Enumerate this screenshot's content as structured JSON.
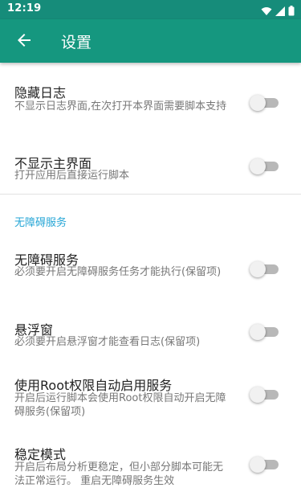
{
  "status_bar": {
    "time": "12:19",
    "icons": [
      "wifi-icon",
      "signal-icon",
      "battery-icon"
    ]
  },
  "app_bar": {
    "title": "设置",
    "back_icon": "arrow-back-icon",
    "color": "#15977f"
  },
  "settings": [
    {
      "title": "隐藏日志",
      "summary": "不显示日志界面,在次打开本界面需要脚本支持",
      "enabled": false
    },
    {
      "title": "不显示主界面",
      "summary": "打开应用后直接运行脚本",
      "enabled": false
    }
  ],
  "category": {
    "label": "无障碍服务",
    "color": "#26a6d6"
  },
  "accessibility_settings": [
    {
      "title": "无障碍服务",
      "summary": "必须要开启无障碍服务任务才能执行(保留项)",
      "enabled": false
    },
    {
      "title": "悬浮窗",
      "summary": "必须要开启悬浮窗才能查看日志(保留项)",
      "enabled": false
    },
    {
      "title": "使用Root权限自动启用服务",
      "summary": "开启后运行脚本会使用Root权限自动开启无障碍服务(保留项)",
      "enabled": false
    },
    {
      "title": "稳定模式",
      "summary": "开启后布局分析更稳定，但小部分脚本可能无法正常运行。 重启无障碍服务生效",
      "enabled": false
    }
  ]
}
